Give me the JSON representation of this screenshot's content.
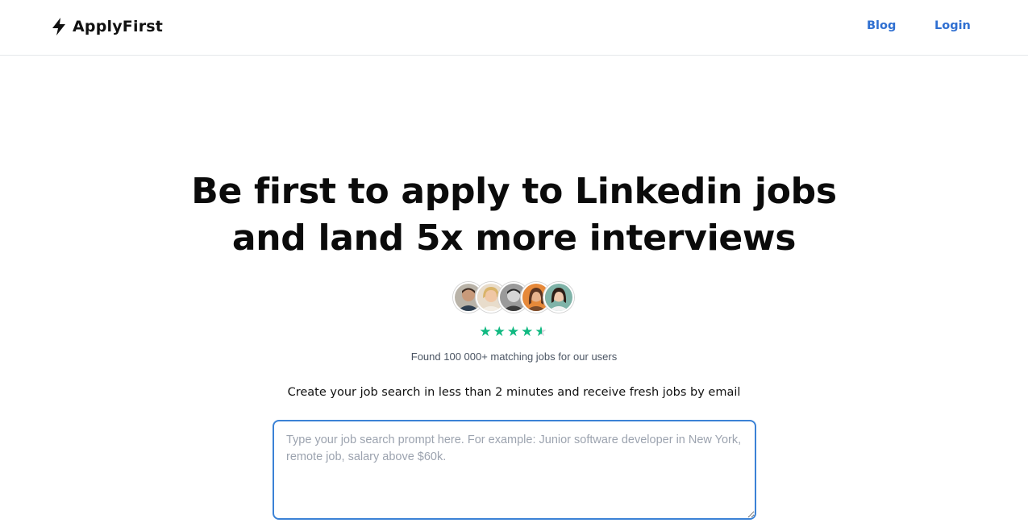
{
  "header": {
    "brand_name": "ApplyFirst",
    "nav": {
      "blog_label": "Blog",
      "login_label": "Login"
    },
    "link_color": "#2f6fd1"
  },
  "hero": {
    "title_line_1": "Be first to apply to Linkedin jobs",
    "title_line_2": "and land 5x more interviews"
  },
  "social_proof": {
    "avatars": [
      "user-avatar-1",
      "user-avatar-2",
      "user-avatar-3",
      "user-avatar-4",
      "user-avatar-5"
    ],
    "rating": 4.5,
    "rating_max": 5,
    "star_color": "#10b981",
    "found_text": "Found 100 000+ matching jobs for our users"
  },
  "search": {
    "subtitle": "Create your job search in less than 2 minutes and receive fresh jobs by email",
    "prompt_value": "",
    "prompt_placeholder": "Type your job search prompt here. For example: Junior software developer in New York, remote job, salary above $60k.",
    "border_color": "#3b82d6"
  }
}
